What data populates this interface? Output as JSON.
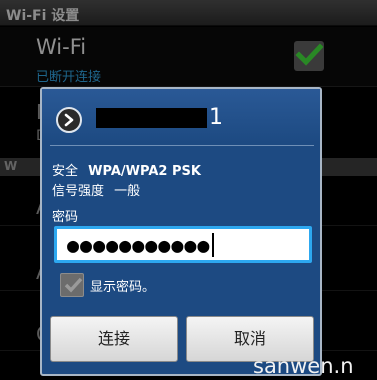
{
  "background": {
    "title": "Wi-Fi 设置",
    "wifi_row": {
      "title": "Wi-Fi",
      "status": "已断开连接"
    },
    "section_fragment": "W",
    "fragments": [
      "N",
      "D",
      "A",
      "A",
      "C"
    ]
  },
  "dialog": {
    "ssid_suffix": "1",
    "security_label": "安全",
    "security_value": "WPA/WPA2 PSK",
    "signal_label": "信号强度",
    "signal_value": "一般",
    "password_label": "密码",
    "password_value": "●●●●●●●●●●●",
    "show_password_label": "显示密码。",
    "show_password_checked": true,
    "connect_button": "连接",
    "cancel_button": "取消"
  },
  "watermark": "sanwen.n",
  "colors": {
    "dialog_bg": "#1d4a82",
    "input_focus": "#2da8f0",
    "status_blue": "#2f9bd6"
  },
  "icons": {
    "header_icon": "chevron-right-icon",
    "check": "check-icon"
  }
}
